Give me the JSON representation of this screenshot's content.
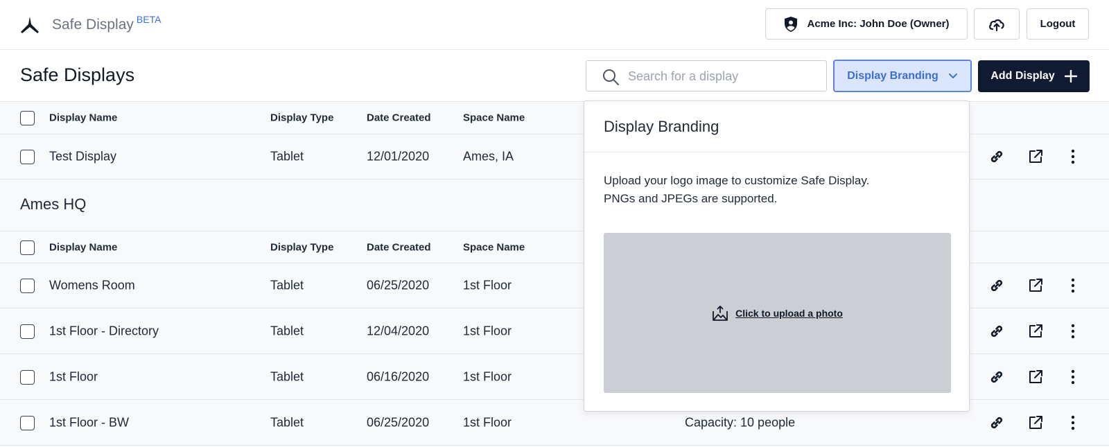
{
  "app": {
    "name": "Safe Display",
    "badge": "BETA"
  },
  "header": {
    "org_user": "Acme Inc: John Doe (Owner)",
    "logout": "Logout"
  },
  "toolbar": {
    "title": "Safe Displays",
    "search_placeholder": "Search for a display",
    "branding_label": "Display Branding",
    "add_label": "Add Display"
  },
  "columns": [
    "Display Name",
    "Display Type",
    "Date Created",
    "Space Name"
  ],
  "ungrouped": [
    {
      "name": "Test Display",
      "type": "Tablet",
      "date": "12/01/2020",
      "space": "Ames, IA",
      "extra": ""
    }
  ],
  "groups": [
    {
      "title": "Ames HQ",
      "rows": [
        {
          "name": "Womens Room",
          "type": "Tablet",
          "date": "06/25/2020",
          "space": "1st Floor",
          "extra": ""
        },
        {
          "name": "1st Floor - Directory",
          "type": "Tablet",
          "date": "12/04/2020",
          "space": "1st Floor",
          "extra": ""
        },
        {
          "name": "1st Floor",
          "type": "Tablet",
          "date": "06/16/2020",
          "space": "1st Floor",
          "extra": ""
        },
        {
          "name": "1st Floor - BW",
          "type": "Tablet",
          "date": "06/25/2020",
          "space": "1st Floor",
          "extra": "Capacity: 10 people"
        }
      ]
    }
  ],
  "popover": {
    "title": "Display Branding",
    "desc_line1": "Upload your logo image to customize Safe Display.",
    "desc_line2": "PNGs and JPEGs are supported.",
    "upload_label": "Click to upload a photo"
  },
  "colors": {
    "accent": "#3b6fd8",
    "primary_button": "#111a33",
    "dropzone": "#cbced3"
  }
}
